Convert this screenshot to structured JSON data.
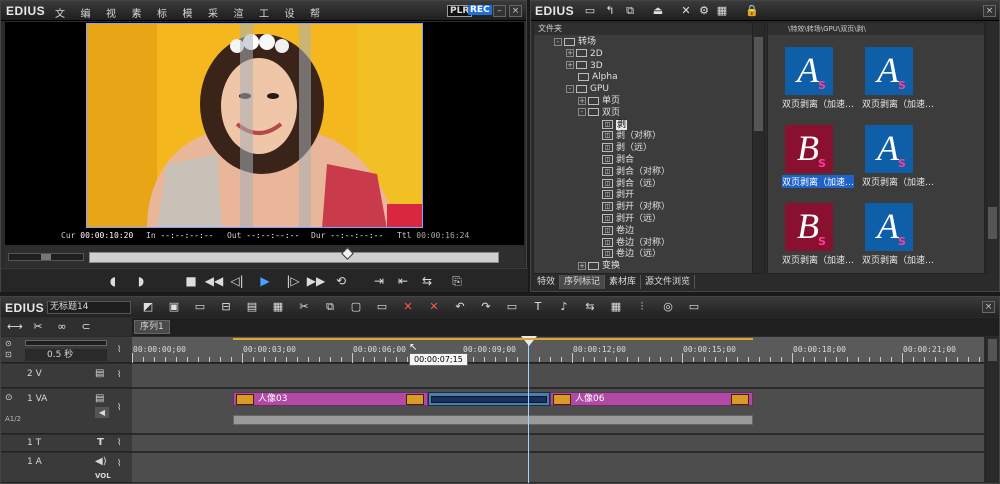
{
  "player": {
    "logo": "EDIUS",
    "menu": [
      "文件",
      "编辑",
      "视图",
      "素材",
      "标记",
      "模式",
      "采集",
      "渲染",
      "工具",
      "设置",
      "帮助"
    ],
    "plr": "PLR",
    "rec": "REC",
    "timecodes": {
      "cur_label": "Cur",
      "cur": "00:00:10:20",
      "in_label": "In",
      "in": "--:--:--:--",
      "out_label": "Out",
      "out": "--:--:--:--",
      "dur_label": "Dur",
      "dur": "--:--:--:--",
      "ttl_label": "Ttl",
      "ttl": "00:00:16:24"
    }
  },
  "bin": {
    "logo": "EDIUS",
    "tree_header": "文件夹",
    "tree": [
      {
        "label": "转场",
        "kind": "folder",
        "toggle": "-",
        "indent": 0
      },
      {
        "label": "2D",
        "kind": "folder",
        "toggle": "+",
        "indent": 1
      },
      {
        "label": "3D",
        "kind": "folder",
        "toggle": "+",
        "indent": 1
      },
      {
        "label": "Alpha",
        "kind": "folder",
        "toggle": "",
        "indent": 1
      },
      {
        "label": "GPU",
        "kind": "folder",
        "toggle": "-",
        "indent": 1
      },
      {
        "label": "单页",
        "kind": "folder",
        "toggle": "+",
        "indent": 2
      },
      {
        "label": "双页",
        "kind": "folder",
        "toggle": "-",
        "indent": 2
      },
      {
        "label": "剥",
        "kind": "fx",
        "toggle": "",
        "indent": 3,
        "selected": true
      },
      {
        "label": "剥（对称）",
        "kind": "fx",
        "toggle": "",
        "indent": 3
      },
      {
        "label": "剥（远）",
        "kind": "fx",
        "toggle": "",
        "indent": 3
      },
      {
        "label": "剥合",
        "kind": "fx",
        "toggle": "",
        "indent": 3
      },
      {
        "label": "剥合（对称）",
        "kind": "fx",
        "toggle": "",
        "indent": 3
      },
      {
        "label": "剥合（远）",
        "kind": "fx",
        "toggle": "",
        "indent": 3
      },
      {
        "label": "剥开",
        "kind": "fx",
        "toggle": "",
        "indent": 3
      },
      {
        "label": "剥开（对称）",
        "kind": "fx",
        "toggle": "",
        "indent": 3
      },
      {
        "label": "剥开（远）",
        "kind": "fx",
        "toggle": "",
        "indent": 3
      },
      {
        "label": "卷边",
        "kind": "fx",
        "toggle": "",
        "indent": 3
      },
      {
        "label": "卷边（对称）",
        "kind": "fx",
        "toggle": "",
        "indent": 3
      },
      {
        "label": "卷边（远）",
        "kind": "fx",
        "toggle": "",
        "indent": 3
      },
      {
        "label": "变换",
        "kind": "folder",
        "toggle": "+",
        "indent": 2
      }
    ],
    "path": "\\特效\\转场\\GPU\\双页\\剥\\",
    "thumbs": [
      {
        "letter": "A",
        "caption": "双页剥离（加速…",
        "bg": "#0e5ea8",
        "selected": false
      },
      {
        "letter": "A",
        "caption": "双页剥离（加速…",
        "bg": "#0e5ea8",
        "selected": false
      },
      {
        "letter": "B",
        "caption": "双页剥离（加速…",
        "bg": "#8a1030",
        "selected": true
      },
      {
        "letter": "A",
        "caption": "双页剥离（加速…",
        "bg": "#0e5ea8",
        "selected": false
      },
      {
        "letter": "B",
        "caption": "双页剥离（加速…",
        "bg": "#8a1030",
        "selected": false
      },
      {
        "letter": "A",
        "caption": "双页剥离（加速…",
        "bg": "#0e5ea8",
        "selected": false
      }
    ],
    "tabs": [
      "特效",
      "序列标记",
      "素材库",
      "源文件浏览"
    ]
  },
  "timeline": {
    "logo": "EDIUS",
    "project_name": "无标题14",
    "sequence_tab": "序列1",
    "zoom": "0.5 秒",
    "ruler": [
      "00:00:00;00",
      "00:00:03;00",
      "00:00:06;00",
      "00:00:09;00",
      "00:00:12;00",
      "00:00:15;00",
      "00:00:18;00",
      "00:00:21;00"
    ],
    "hover_tc": "00:00:07;15",
    "tracks": {
      "v2": "2 V",
      "va1": "1 VA",
      "t1": "1 T",
      "a1": "1 A",
      "vol": "VOL"
    },
    "clip1": "人像03",
    "clip2": "人像06"
  }
}
